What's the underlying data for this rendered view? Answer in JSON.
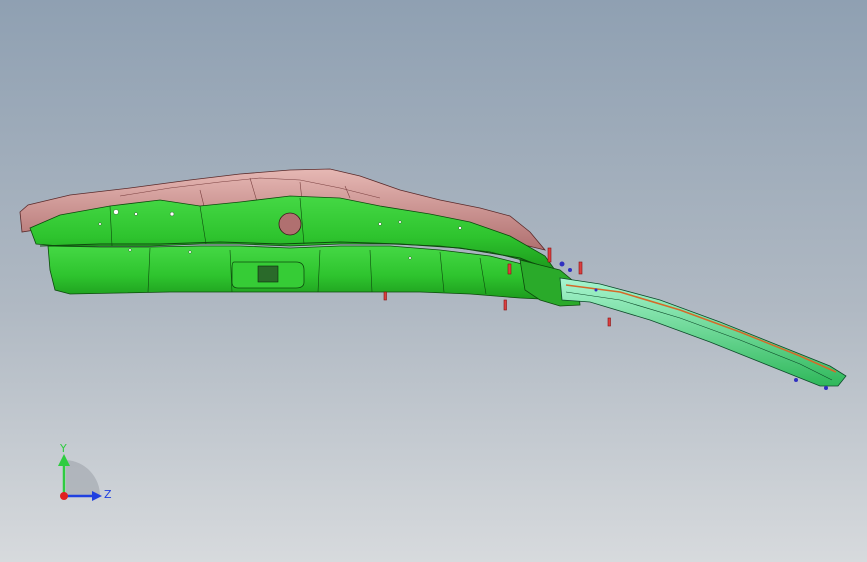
{
  "viewport": {
    "background_top": "#8fa0b2",
    "background_bottom": "#d7dadd"
  },
  "model": {
    "body_color": "#2ec42e",
    "body_shadow": "#1a8a1a",
    "inner_color": "#c48f8f",
    "rail_color": "#3ad06a",
    "rail_inner": "#9ff0c8",
    "rail_stripe": "#d46a2a",
    "pin_color": "#d94040",
    "fastener_color": "#3030c0"
  },
  "triad": {
    "y_label": "Y",
    "z_label": "Z",
    "y_color": "#2ecc40",
    "z_color": "#2040e0",
    "origin_color": "#e02020",
    "icon": "coordinate-triad-icon"
  }
}
